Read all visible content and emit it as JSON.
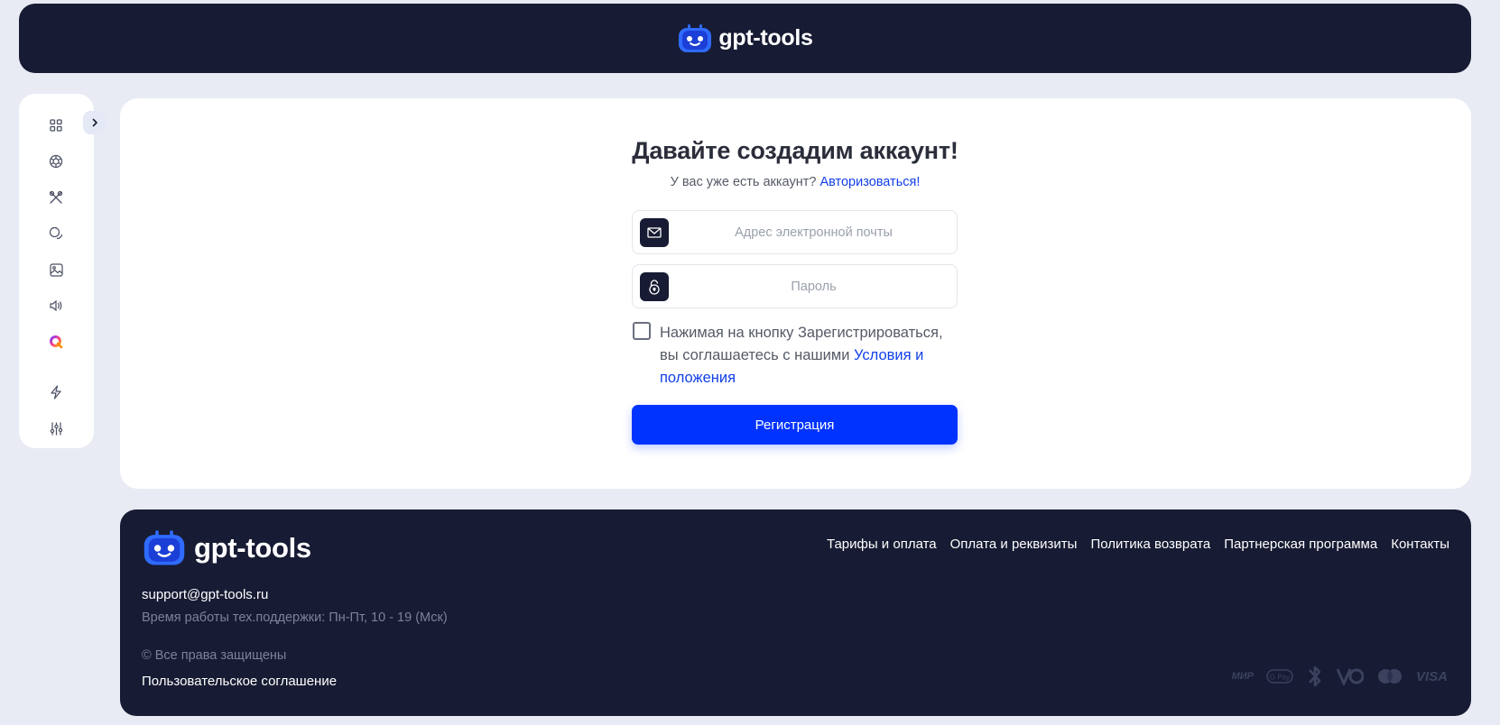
{
  "header": {
    "logo_text": "gpt-tools"
  },
  "sidebar": {
    "items": [
      {
        "icon": "grid-icon",
        "label": "Dashboard"
      },
      {
        "icon": "openai-icon",
        "label": "ChatGPT"
      },
      {
        "icon": "tools-icon",
        "label": "Tools"
      },
      {
        "icon": "chat-icon",
        "label": "Chats"
      },
      {
        "icon": "image-icon",
        "label": "Images"
      },
      {
        "icon": "audio-icon",
        "label": "Audio"
      },
      {
        "icon": "gradient-q-icon",
        "label": "Q"
      },
      {
        "icon": "lightning-icon",
        "label": "Pro"
      },
      {
        "icon": "sliders-icon",
        "label": "Settings"
      }
    ],
    "toggle_icon": "chevron-right-icon"
  },
  "form": {
    "title": "Давайте создадим аккаунт!",
    "subtitle_text": "У вас уже есть аккаунт?",
    "login_link": "Авторизоваться!",
    "email_placeholder": "Адрес электронной почты",
    "email_value": "",
    "password_placeholder": "Пароль",
    "password_value": "",
    "terms_text": "Нажимая на кнопку Зарегистрироваться, вы соглашаетесь с нашими",
    "terms_link": "Условия и положения",
    "terms_checked": false,
    "register_button": "Регистрация"
  },
  "footer": {
    "logo_text": "gpt-tools",
    "links": [
      "Тарифы и оплата",
      "Оплата и реквизиты",
      "Политика возврата",
      "Партнерская программа",
      "Контакты"
    ],
    "support_email": "support@gpt-tools.ru",
    "support_hours": "Время работы тех.поддержки: Пн-Пт, 10 - 19 (Мск)",
    "copyright": "© Все права защищены",
    "user_agreement": "Пользовательское соглашение",
    "payments": [
      "МИР",
      "G Pay",
      "Bluetooth-like",
      "ЮMoney",
      "Mastercard",
      "VISA"
    ]
  },
  "colors": {
    "navy": "#171b33",
    "accent": "#0033ff",
    "link": "#1340e8",
    "page_bg": "#e8ebf3"
  }
}
